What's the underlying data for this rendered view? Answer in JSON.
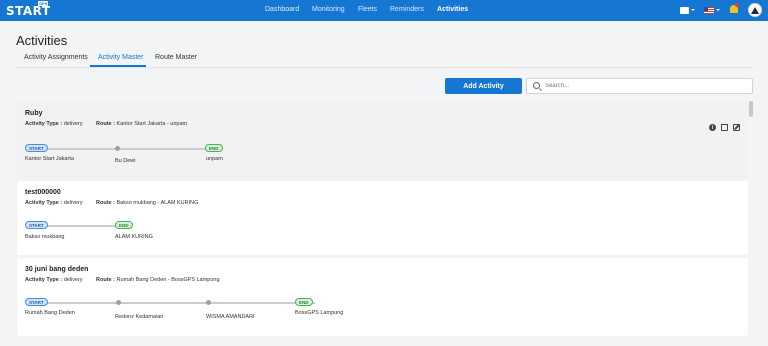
{
  "nav": {
    "logo_text": "START",
    "logo_badge": "GPS",
    "items": [
      {
        "label": "Dashboard",
        "active": false
      },
      {
        "label": "Monitoring",
        "active": false
      },
      {
        "label": "Fleets",
        "active": false
      },
      {
        "label": "Reminders",
        "active": false
      },
      {
        "label": "Activities",
        "active": true
      }
    ],
    "icons": [
      "book-icon",
      "us-flag-icon",
      "bell-icon",
      "avatar-icon"
    ]
  },
  "page": {
    "title": "Activities",
    "tabs": [
      {
        "label": "Activity Assignments",
        "active": false
      },
      {
        "label": "Activity Master",
        "active": true
      },
      {
        "label": "Route Master",
        "active": false
      }
    ]
  },
  "toolbar": {
    "add_label": "Add Activity",
    "search_placeholder": "Search..."
  },
  "activities": [
    {
      "name": "Ruby",
      "type_label": "Activity Type :",
      "type_value": "delivery",
      "route_label": "Route :",
      "route_value": "Kantor Start Jakarta - unpam",
      "start_badge": "START",
      "end_badge": "END",
      "stops": [
        "Kantor Start Jakarta",
        "Bu Dewi",
        "unpam"
      ]
    },
    {
      "name": "test000000",
      "type_label": "Activity Type :",
      "type_value": "delivery",
      "route_label": "Route :",
      "route_value": "Bakso mukbang - ALAM KURING",
      "start_badge": "START",
      "end_badge": "END",
      "stops": [
        "Bakso mukbang",
        "ALAM KURING"
      ]
    },
    {
      "name": "30 juni bang deden",
      "type_label": "Activity Type :",
      "type_value": "delivery",
      "route_label": "Route :",
      "route_value": "Rumah Bang Deden - BossGPS Lampung",
      "start_badge": "START",
      "end_badge": "END",
      "stops": [
        "Rumah Bang Deden",
        "Redonz Kedamaian",
        "WISMA AMANDARI",
        "BossGPS Lampung"
      ]
    }
  ],
  "colors": {
    "primary": "#1677d2",
    "start_badge": "#cfe3f8",
    "end_badge": "#d6f3d8"
  }
}
